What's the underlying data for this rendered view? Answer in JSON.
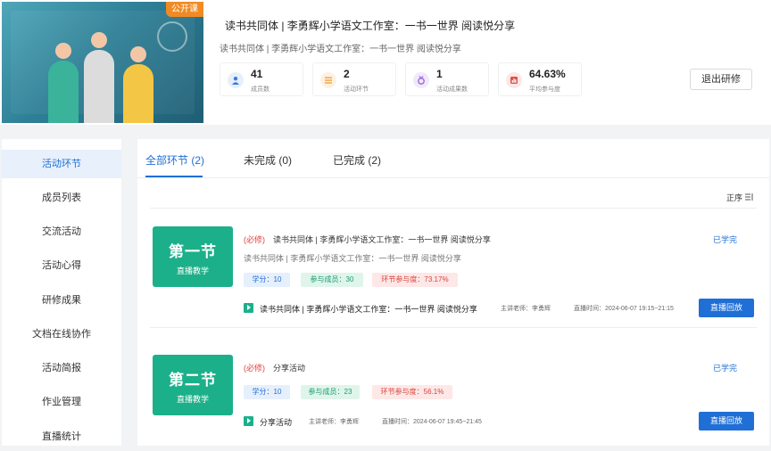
{
  "header": {
    "banner_tag": "公开课",
    "title": "读书共同体 | 李勇辉小学语文工作室：一书一世界 阅读悦分享",
    "subtitle": "读书共同体 | 李勇辉小学语文工作室：一书一世界 阅读悦分享",
    "exit_label": "退出研修",
    "stats": [
      {
        "value": "41",
        "label": "成员数",
        "icon": "user-icon",
        "color": "#3d7bd9",
        "bg": "#e7effb"
      },
      {
        "value": "2",
        "label": "活动环节",
        "icon": "list-icon",
        "color": "#f29a30",
        "bg": "#fdf1e3"
      },
      {
        "value": "1",
        "label": "活动成果数",
        "icon": "medal-icon",
        "color": "#9a6ad6",
        "bg": "#f1e9fb"
      },
      {
        "value": "64.63%",
        "label": "平均参与度",
        "icon": "chart-icon",
        "color": "#e0514a",
        "bg": "#fce8e7"
      }
    ]
  },
  "sidebar": {
    "items": [
      {
        "label": "活动环节",
        "active": true
      },
      {
        "label": "成员列表"
      },
      {
        "label": "交流活动"
      },
      {
        "label": "活动心得"
      },
      {
        "label": "研修成果"
      },
      {
        "label": "文档在线协作"
      },
      {
        "label": "活动简报"
      },
      {
        "label": "作业管理"
      },
      {
        "label": "直播统计"
      }
    ]
  },
  "tabs": [
    {
      "label": "全部环节 (2)"
    },
    {
      "label": "未完成 (0)"
    },
    {
      "label": "已完成 (2)"
    }
  ],
  "sort_label": "正序",
  "sections": [
    {
      "badge_title": "第一节",
      "badge_sub": "直播教学",
      "required": "(必修)",
      "title": "读书共同体 | 李勇辉小学语文工作室：一书一世界 阅读悦分享",
      "desc": "读书共同体 | 李勇辉小学语文工作室：一书一世界 阅读悦分享",
      "status": "已学完",
      "credit": "学分：10",
      "members": "参与成员：30",
      "rate": "环节参与度：73.17%",
      "resource": "读书共同体 | 李勇辉小学语文工作室：一书一世界 阅读悦分享",
      "teacher": "主讲老师：李勇辉",
      "time": "直播时间：2024-06-07 19:15~21:15",
      "button": "直播回放"
    },
    {
      "badge_title": "第二节",
      "badge_sub": "直播教学",
      "required": "(必修)",
      "title": "分享活动",
      "status": "已学完",
      "credit": "学分：10",
      "members": "参与成员：23",
      "rate": "环节参与度：56.1%",
      "resource": "分享活动",
      "teacher": "主讲老师：李勇辉",
      "time": "直播时间：2024-06-07 19:45~21:45",
      "button": "直播回放"
    }
  ]
}
